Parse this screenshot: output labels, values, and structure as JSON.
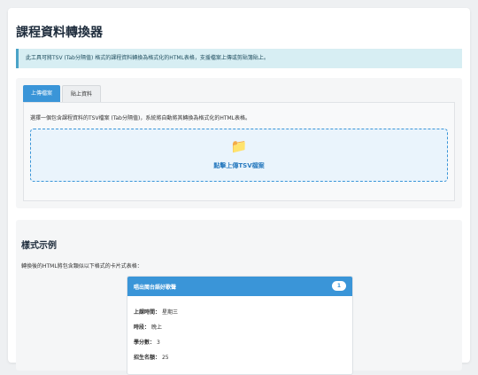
{
  "page": {
    "title": "課程資料轉換器"
  },
  "info": {
    "text": "此工具可將TSV (Tab分隔值) 格式的課程資料轉換為格式化的HTML表格，支援檔案上傳或剪貼簿貼上。"
  },
  "tabs": [
    {
      "label": "上傳檔案",
      "active": true
    },
    {
      "label": "貼上資料",
      "active": false
    }
  ],
  "upload": {
    "instruction": "選擇一個包含課程資料的TSV檔案 (Tab分隔值)，系統將自動將其轉換為格式化的HTML表格。",
    "icon": "folder-icon",
    "drop_label": "點擊上傳TSV檔案"
  },
  "example": {
    "title": "樣式示例",
    "description": "轉換後的HTML將包含類似以下格式的卡片式表格：",
    "card": {
      "title": "唱出閩台語好歌聲",
      "badge": "1",
      "fields": [
        {
          "label": "上課時間：",
          "value": "星期三"
        },
        {
          "label": "時段：",
          "value": "晚上"
        },
        {
          "label": "學分數：",
          "value": "3"
        },
        {
          "label": "招生名額：",
          "value": "25"
        }
      ]
    }
  },
  "colors": {
    "accent": "#3a95d8",
    "info_bg": "#d7eef3",
    "dropzone_bg": "#eaf4fc"
  }
}
